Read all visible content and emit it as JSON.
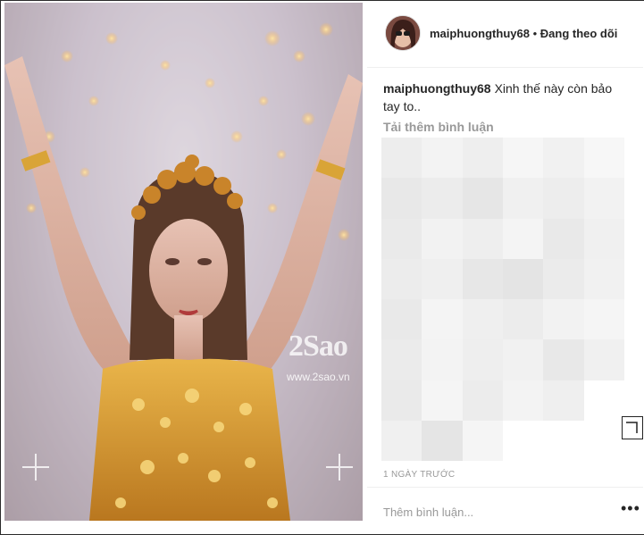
{
  "post": {
    "username": "maiphuongthuy68",
    "separator": "•",
    "follow_status": "Đang theo dõi",
    "caption_text": "Xinh thế này còn bảo tay to..",
    "load_more_comments": "Tải thêm bình luận",
    "timestamp": "1 NGÀY TRƯỚC",
    "comment_placeholder": "Thêm bình luận...",
    "more_options": "•••"
  },
  "photo": {
    "watermark_logo": "2Sao",
    "watermark_url": "www.2sao.vn"
  },
  "colors": {
    "text": "#262626",
    "muted": "#999999",
    "gold": "#d9a437"
  }
}
